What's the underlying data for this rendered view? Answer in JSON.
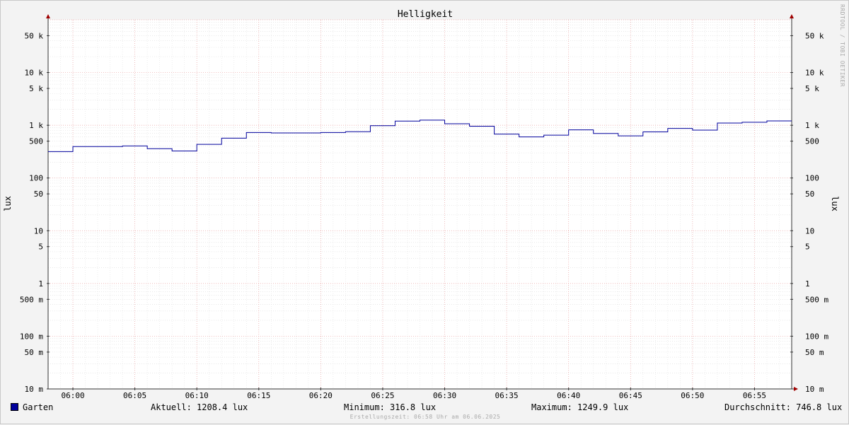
{
  "title": "Helligkeit",
  "ylabel": "lux",
  "watermark": "RRDTOOL / TOBI OETIKER",
  "footer": "Erstellungszeit: 06:58 Uhr am 06.06.2025",
  "legend": {
    "series_name": "Garten",
    "series_color": "#00009c",
    "current": "Aktuell: 1208.4 lux",
    "minimum": "Minimum: 316.8 lux",
    "maximum": "Maximum: 1249.9 lux",
    "average": "Durchschnitt: 746.8 lux"
  },
  "chart_data": {
    "type": "line",
    "step": true,
    "yscale": "log",
    "ylim": [
      0.01,
      100000
    ],
    "y_ticks": [
      {
        "value": 0.01,
        "label": "10 m"
      },
      {
        "value": 0.05,
        "label": "50 m"
      },
      {
        "value": 0.1,
        "label": "100 m"
      },
      {
        "value": 0.5,
        "label": "500 m"
      },
      {
        "value": 1,
        "label": "1"
      },
      {
        "value": 5,
        "label": "5"
      },
      {
        "value": 10,
        "label": "10"
      },
      {
        "value": 50,
        "label": "50"
      },
      {
        "value": 100,
        "label": "100"
      },
      {
        "value": 500,
        "label": "500"
      },
      {
        "value": 1000,
        "label": "1 k"
      },
      {
        "value": 5000,
        "label": "5 k"
      },
      {
        "value": 10000,
        "label": "10 k"
      },
      {
        "value": 50000,
        "label": "50 k"
      }
    ],
    "xlim": [
      "05:58",
      "06:58"
    ],
    "x_ticks": [
      "06:00",
      "06:05",
      "06:10",
      "06:15",
      "06:20",
      "06:25",
      "06:30",
      "06:35",
      "06:40",
      "06:45",
      "06:50",
      "06:55"
    ],
    "grid": true,
    "series": [
      {
        "name": "Garten",
        "color": "#00009c",
        "x": [
          "05:58",
          "06:00",
          "06:02",
          "06:04",
          "06:06",
          "06:08",
          "06:10",
          "06:12",
          "06:14",
          "06:16",
          "06:18",
          "06:20",
          "06:22",
          "06:24",
          "06:26",
          "06:28",
          "06:30",
          "06:32",
          "06:34",
          "06:36",
          "06:38",
          "06:40",
          "06:42",
          "06:44",
          "06:46",
          "06:48",
          "06:50",
          "06:52",
          "06:54",
          "06:56"
        ],
        "values": [
          317,
          395,
          395,
          405,
          360,
          325,
          435,
          570,
          730,
          715,
          715,
          730,
          755,
          980,
          1200,
          1250,
          1070,
          960,
          680,
          600,
          650,
          820,
          700,
          630,
          750,
          870,
          810,
          1100,
          1140,
          1208
        ]
      }
    ]
  }
}
